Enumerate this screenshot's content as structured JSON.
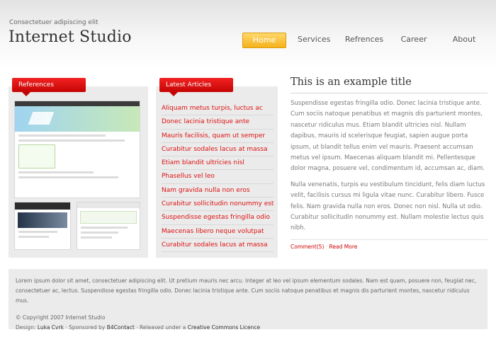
{
  "header": {
    "tagline": "Consectetuer adipiscing elit",
    "logo": "Internet Studio"
  },
  "nav": {
    "items": [
      "Home",
      "Services",
      "Refrences",
      "Career",
      "About"
    ],
    "active": "Home"
  },
  "references": {
    "title": "References",
    "thumbnails": [
      "website-screenshot-1",
      "website-screenshot-2",
      "website-screenshot-3"
    ]
  },
  "articles": {
    "title": "Latest Articles",
    "items": [
      "Aliquam metus turpis, luctus ac",
      "Donec lacinia tristique ante",
      "Mauris facilisis, quam ut semper",
      "Curabitur sodales lacus at massa",
      "Etiam blandit ultricies nisl",
      "Phasellus vel leo",
      "Nam gravida nulla non eros",
      "Curabitur sollicitudin nonummy est",
      "Suspendisse egestas fringilla odio",
      "Maecenas libero neque volutpat",
      "Curabitur sodales lacus at massa"
    ]
  },
  "main": {
    "title": "This is an example title",
    "paragraph1": "Suspendisse egestas fringilla odio. Donec lacinia tristique ante. Cum sociis natoque penatibus et magnis dis parturient montes, nascetur ridiculus mus. Etiam blandit ultricies nisl. Nullam dapibus, mauris id scelerisque feugiat, sapien augue porta ipsum, ut blandit tellus enim vel mauris. Praesent accumsan metus vel ipsum. Maecenas aliquam blandit mi. Pellentesque dolor magna, posuere vel, condimentum id, accumsan ac, diam.",
    "paragraph2": "Nulla venenatis, turpis eu vestibulum tincidunt, felis diam luctus velit, facilisis cursus mi ligula vitae nunc. Curabitur libero. Fusce felis. Nam gravida nulla non eros. Donec non nisl. Nulla ut odio. Curabitur sollicitudin nonummy est. Nullam molestie lectus quis nibh.",
    "comments": "Comment(5)",
    "separator": "·",
    "read_more": "Read More"
  },
  "footer": {
    "text": "Lorem ipsum dolor sit amet, consectetuer adipiscing elit. Ut pretium mauris nec arcu. Integer at leo vel ipsum elementum sodales. Nam est quam, posuere non, feugiat nec, consectetuer ac, lectus. Suspendisse egestas fringilla odio. Donec lacinia tristique ante. Cum sociis natoque penatibus et magnis dis parturient montes, nascetur ridiculus mus.",
    "copyright": "© Copyright 2007 Internet Studio",
    "design_label": "Design:",
    "designer": "Luka Cvrk",
    "sponsored_label": "· Sponsored by",
    "sponsor": "B4Contact",
    "released_label": "· Released under a",
    "licence": "Creative Commons Licence"
  },
  "colors": {
    "accent_red": "#d11111",
    "nav_active": "#f5b21c",
    "panel_bg": "#ebebeb"
  }
}
